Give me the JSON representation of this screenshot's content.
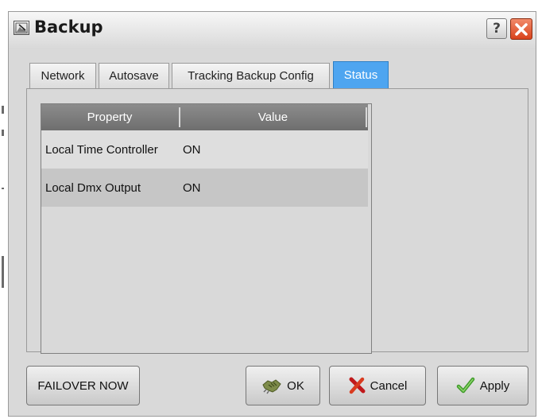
{
  "window": {
    "title": "Backup",
    "help_label": "?"
  },
  "tabs": [
    {
      "label": "Network",
      "active": false
    },
    {
      "label": "Autosave",
      "active": false
    },
    {
      "label": "Tracking Backup Config",
      "active": false
    },
    {
      "label": "Status",
      "active": true
    }
  ],
  "table": {
    "columns": [
      "Property",
      "Value"
    ],
    "rows": [
      {
        "property": "Local Time Controller",
        "value": "ON"
      },
      {
        "property": "Local Dmx Output",
        "value": "ON"
      }
    ]
  },
  "buttons": {
    "failover": "FAILOVER NOW",
    "ok": "OK",
    "cancel": "Cancel",
    "apply": "Apply"
  },
  "icons": {
    "window": "window-app-icon",
    "help": "help-icon",
    "close": "close-icon",
    "ok": "handshake-icon",
    "cancel": "red-x-icon",
    "apply": "green-check-icon"
  },
  "colors": {
    "active_tab": "#4ea5f0",
    "close_button": "#d9431c",
    "header_bar": "#7a7a7a",
    "row_highlight": "#c6c6c6"
  }
}
